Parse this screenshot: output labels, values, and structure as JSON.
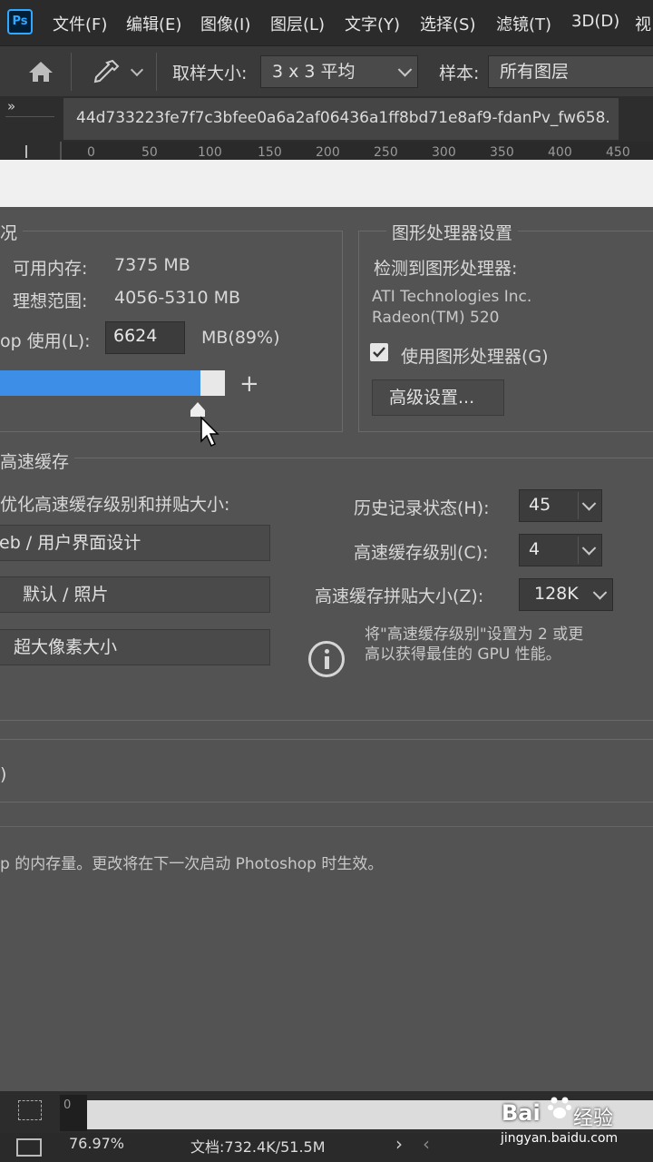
{
  "app": {
    "logo": "Ps",
    "menu": [
      "文件(F)",
      "编辑(E)",
      "图像(I)",
      "图层(L)",
      "文字(Y)",
      "选择(S)",
      "滤镜(T)",
      "3D(D)",
      "视"
    ]
  },
  "options": {
    "sample_size_label": "取样大小:",
    "sample_size_value": "3 x 3 平均",
    "sample_label": "样本:",
    "sample_value": "所有图层"
  },
  "document": {
    "tab_title": "44d733223fe7f7c3bfee0a6a2af06436a1ff8bd71e8af9-fdanPv_fw658.",
    "ruler_ticks": [
      "0",
      "50",
      "100",
      "150",
      "200",
      "250",
      "300",
      "350",
      "400",
      "450"
    ],
    "collapse_glyph": "»"
  },
  "memory": {
    "section_title": "况",
    "available_label": "可用内存:",
    "available_value": "7375 MB",
    "ideal_label": "理想范围:",
    "ideal_value": "4056-5310 MB",
    "usage_label": "op 使用(L):",
    "usage_value": "6624",
    "usage_unit": "MB(89%)",
    "usage_fraction": 0.89,
    "plus": "+"
  },
  "gpu": {
    "section_title": "图形处理器设置",
    "detected_label": "检测到图形处理器:",
    "vendor": "ATI Technologies Inc.",
    "model": "Radeon(TM) 520",
    "use_gpu_label": "使用图形处理器(G)",
    "use_gpu_checked": true,
    "advanced_button": "高级设置..."
  },
  "cache": {
    "section_title": "高速缓存",
    "optimize_label": "优化高速缓存级别和拼贴大小:",
    "presets": [
      "eb / 用户界面设计",
      "默认 / 照片",
      "超大像素大小"
    ],
    "history_label": "历史记录状态(H):",
    "history_value": "45",
    "levels_label": "高速缓存级别(C):",
    "levels_value": "4",
    "tile_label": "高速缓存拼贴大小(Z):",
    "tile_value": "128K",
    "info_text_1": "将\"高速缓存级别\"设置为 2 或更",
    "info_text_2": "高以获得最佳的 GPU 性能。"
  },
  "scratch": {
    "fragment": ")"
  },
  "footer_note": "p 的内存量。更改将在下一次启动 Photoshop 时生效。",
  "status": {
    "zoom": "76.97%",
    "doc_size": "文档:732.4K/51.5M",
    "arrow": "›",
    "left_arrow": "‹",
    "ruler_zero": "0"
  },
  "watermark": {
    "brand": "Bai",
    "brand2": "经验",
    "url": "jingyan.baidu.com"
  },
  "colors": {
    "accent_bar": "#3d8ee6",
    "panel_bg": "#535353",
    "menubar_bg": "#2b2b2b"
  }
}
